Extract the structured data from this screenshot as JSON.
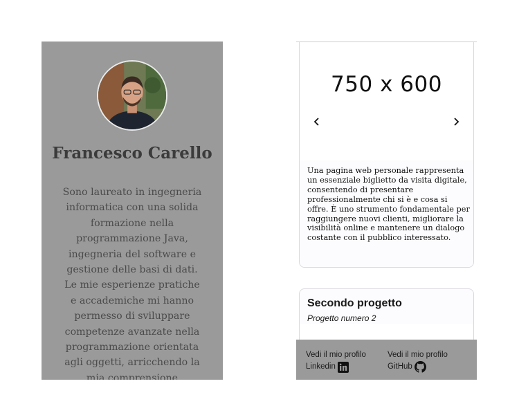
{
  "profile": {
    "name": "Francesco Carello",
    "bio": "Sono laureato in ingegneria informatica con una solida formazione nella programmazione Java, ingegneria del software e gestione delle basi di dati. Le mie esperienze pratiche e accademiche mi hanno permesso di sviluppare competenze avanzate nella programmazione orientata agli oggetti, arricchendo la mia comprensione"
  },
  "projects": [
    {
      "image_placeholder": "750 x 600",
      "description": "Una pagina web personale rappresenta un essenziale biglietto da visita digitale, consentendo di presentare professionalmente chi si è e cosa si offre. È uno strumento fondamentale per raggiungere nuovi clienti, migliorare la visibilità online e mantenere un dialogo costante con il pubblico interessato."
    },
    {
      "title": "Secondo progetto",
      "subtitle": "Progetto numero 2"
    }
  ],
  "carousel": {
    "prev_icon": "chevron-left-icon",
    "next_icon": "chevron-right-icon"
  },
  "footer": {
    "linkedin": {
      "line1": "Vedi il mio profilo",
      "line2": "Linkedin",
      "icon": "linkedin-icon"
    },
    "github": {
      "line1": "Vedi il mio profilo",
      "line2": "GitHub",
      "icon": "github-icon"
    }
  },
  "colors": {
    "panel_gray": "#9a9a9a",
    "card_border": "#dcd8e0",
    "card_tint": "#fcfbfd",
    "text_dark": "#111111"
  }
}
